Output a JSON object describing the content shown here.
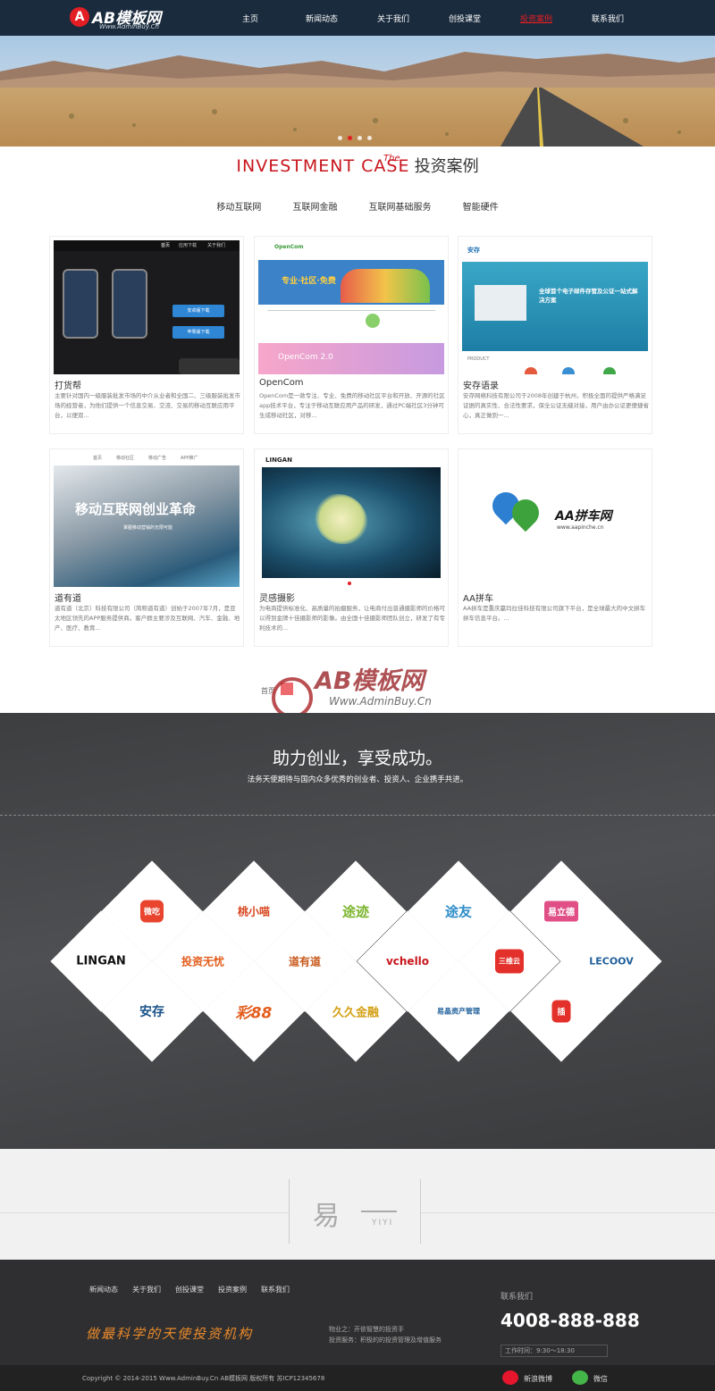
{
  "logo": {
    "title": "AB模板网",
    "subtitle": "Www.AdminBuy.Cn",
    "mark": "A"
  },
  "nav": [
    {
      "label": "主页",
      "active": false
    },
    {
      "label": "新闻动态",
      "active": false
    },
    {
      "label": "关于我们",
      "active": false
    },
    {
      "label": "创投课堂",
      "active": false
    },
    {
      "label": "投资案例",
      "active": true
    },
    {
      "label": "联系我们",
      "active": false
    }
  ],
  "section": {
    "en": "INVESTMENT CASE",
    "the": "The",
    "cn": "投资案例"
  },
  "tabs": [
    "移动互联网",
    "互联网金融",
    "互联网基础服务",
    "智能硬件"
  ],
  "cases": [
    {
      "name": "打货帮",
      "desc": "主要针对国内一级服装批发市场的中介从业者和全国二、三级服装批发市场的经营者，为他们提供一个信息交易、交流、交易的移动互联应用平台，以便双..."
    },
    {
      "name": "OpenCom",
      "desc": "OpenCom是一款专注、专业、免费的移动社区平台和开放、开源的社区app技术平台，专注于移动互联应用产品的研发，通过PC端社区3分钟可生成移动社区，对移..."
    },
    {
      "name": "安存语录",
      "desc": "安存网络科技有限公司于2008年创建于杭州，积极全面的提供严格满足证据的真实性、合法性要求，保全公证无缝对接，用户由办公证更便捷省心，真正做到一..."
    },
    {
      "name": "道有道",
      "desc": "道有道（北京）科技有限公司（简称道有道）创始于2007年7月，是亚太地区领先的APP服务提供商。客户群主要涉及互联网、汽车、金融、地产、医疗、教育..."
    },
    {
      "name": "灵感摄影",
      "desc": "为电商提供标准化、高质量的拍摄服务，让电商付出普通摄影师的价格可以得到金牌十佳摄影师的影像。由全国十佳摄影师团队创立，研发了有专利技术的..."
    },
    {
      "name": "AA拼车",
      "desc": "AA拼车是重庆赢玛拉佳科技有限公司旗下平台，是全球最大的中文拼车拼车信息平台。..."
    }
  ],
  "thumbs": {
    "c1": {
      "nav": [
        "首页",
        "应用下载",
        "关于我们"
      ],
      "btn1": "安卓版下载",
      "btn2": "苹果版下载"
    },
    "c2": {
      "brand": "OpenCom",
      "tagline": "专业·社区·免费",
      "sub": "OpenCom 2.0"
    },
    "c3": {
      "brand": "安存",
      "headline": "全球首个电子邮件存管及公证一站式解决方案",
      "tag": "PRODUCT"
    },
    "c4": {
      "nav": [
        "首页",
        "移动社区",
        "移动广告",
        "APP推广"
      ],
      "headline": "移动互联网创业革命",
      "sub": "掌握移动营销的无限可能"
    },
    "c5": {
      "brand": "LINGAN"
    },
    "c6": {
      "brand": "AA拼车网",
      "url": "www.aapinche.cn"
    }
  },
  "pager": {
    "first": "首页"
  },
  "watermark": {
    "title": "AB模板网",
    "url": "Www.AdminBuy.Cn"
  },
  "slogan": {
    "title": "助力创业，享受成功。",
    "sub": "法务天使期待与国内众多优秀的创业者、投资人、企业携手共进。"
  },
  "partners": [
    "微吃",
    "桃小喵",
    "途迹",
    "途友",
    "易立德",
    "LINGAN",
    "投资无忧",
    "道有道",
    "vchello",
    "三维云",
    "LECOOV",
    "安存",
    "彩88",
    "久久金融",
    "易晶资产管理",
    "插"
  ],
  "yiyi": {
    "cn": "易",
    "en": "YIYI"
  },
  "footer": {
    "nav": [
      "新闻动态",
      "关于我们",
      "创投课堂",
      "投资案例",
      "联系我们"
    ],
    "slogan": "做最科学的天使投资机构",
    "info1": "物业之：开依智慧的投资手",
    "info2": "投资服务：积极的的投资管理及增值服务",
    "contact_label": "联系我们",
    "phone": "4008-888-888",
    "worktime": "工作时间：9:30～18:30",
    "copyright": "Copyright © 2014-2015 Www.AdminBuy.Cn AB模板网 版权所有 苏ICP12345678",
    "weibo": "新浪微博",
    "weixin": "微信"
  },
  "colors": {
    "accent": "#e31e24",
    "header": "#1a2b3d",
    "dark": "#444547",
    "footer": "#2f2f31"
  }
}
